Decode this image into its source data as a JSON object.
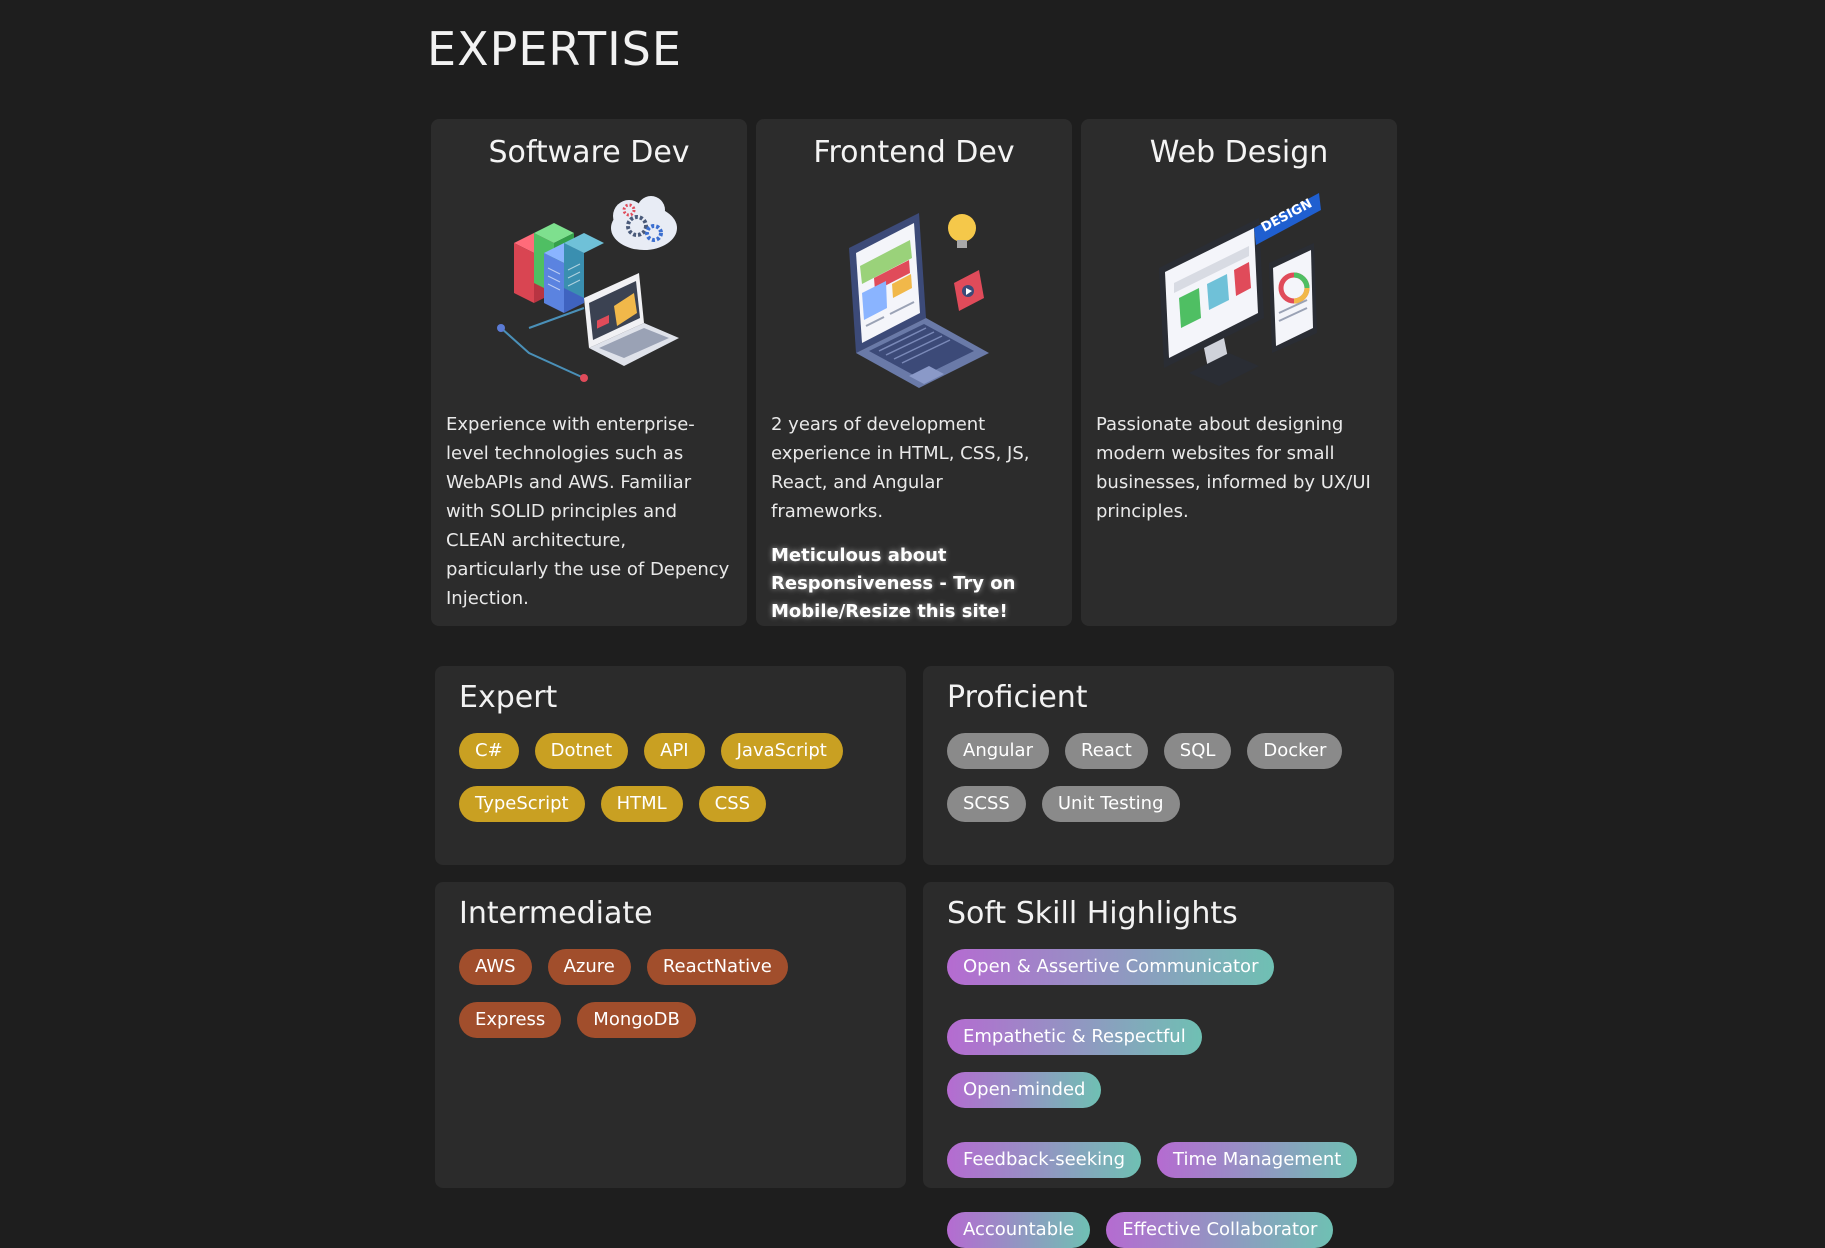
{
  "page": {
    "title": "EXPERTISE"
  },
  "cards": [
    {
      "title": "Software Dev",
      "icon": "server-cloud-laptop-illustration",
      "description": "Experience with enterprise-level technologies such as WebAPIs and AWS. Familiar with SOLID principles and CLEAN architecture, particularly the use of Depency Injection."
    },
    {
      "title": "Frontend Dev",
      "icon": "laptop-web-illustration",
      "description": "2 years of development experience in HTML, CSS, JS, React, and Angular frameworks.",
      "highlight": "Meticulous about Responsiveness - Try on Mobile/Resize this site!"
    },
    {
      "title": "Web Design",
      "icon": "design-monitor-illustration",
      "description": "Passionate about designing modern websites for small businesses, informed by UX/UI principles."
    }
  ],
  "skills": {
    "expert": {
      "title": "Expert",
      "color": "#c9a022",
      "items": [
        "C#",
        "Dotnet",
        "API",
        "JavaScript",
        "TypeScript",
        "HTML",
        "CSS"
      ]
    },
    "proficient": {
      "title": "Proficient",
      "color": "#8a8a8a",
      "items": [
        "Angular",
        "React",
        "SQL",
        "Docker",
        "SCSS",
        "Unit Testing"
      ]
    },
    "intermediate": {
      "title": "Intermediate",
      "color": "#a14e2c",
      "items": [
        "AWS",
        "Azure",
        "ReactNative",
        "Express",
        "MongoDB"
      ]
    },
    "soft": {
      "title": "Soft Skill Highlights",
      "gradient": [
        "#b56bd1",
        "#6fc0b3"
      ],
      "items": [
        "Open & Assertive Communicator",
        "Empathetic & Respectful",
        "Open-minded",
        "Feedback-seeking",
        "Time Management",
        "Accountable",
        "Effective Collaborator"
      ]
    }
  }
}
